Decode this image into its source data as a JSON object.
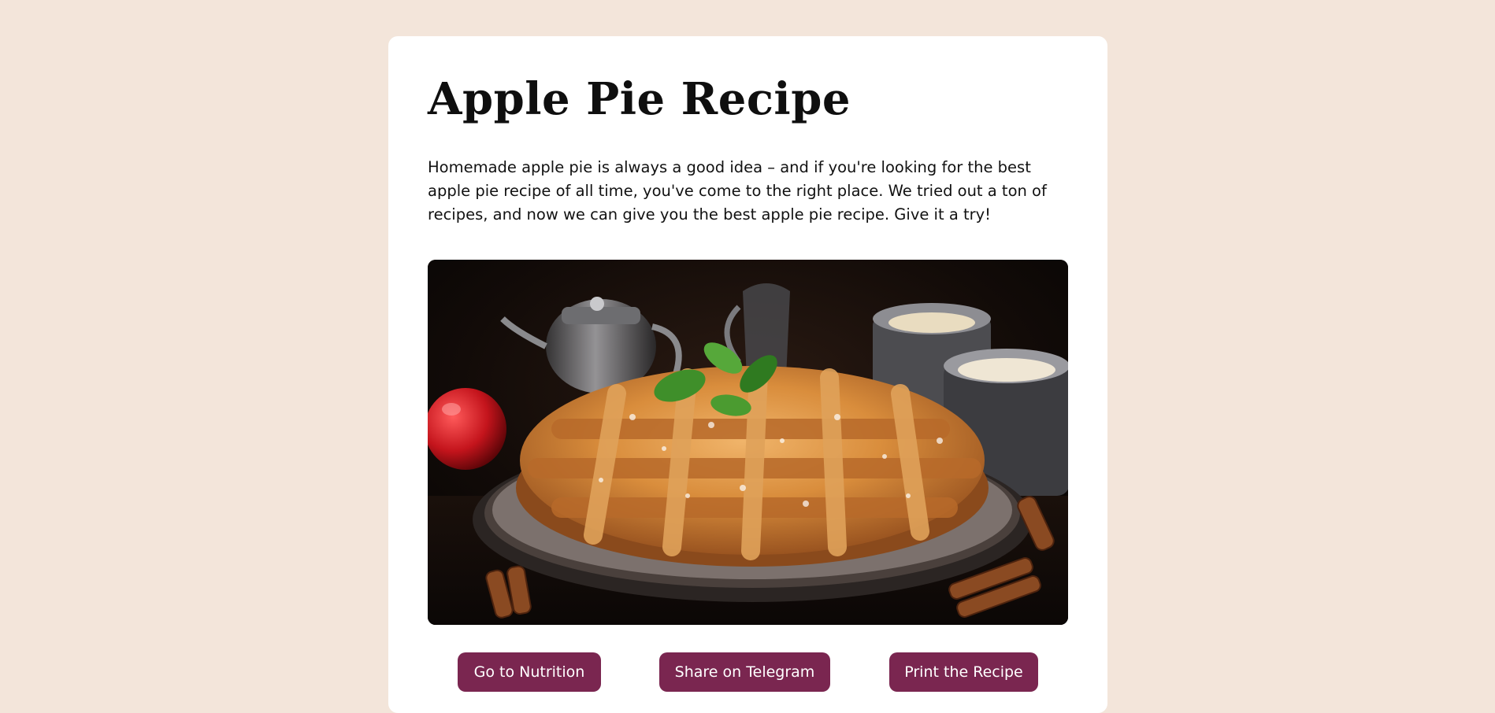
{
  "recipe": {
    "title": "Apple Pie Recipe",
    "intro": "Homemade apple pie is always a good idea – and if you're looking for the best apple pie recipe of all time, you've come to the right place. We tried out a ton of recipes, and now we can give you the best apple pie recipe. Give it a try!"
  },
  "actions": {
    "nutrition_label": "Go to Nutrition",
    "telegram_label": "Share on Telegram",
    "print_label": "Print the Recipe"
  },
  "colors": {
    "page_background": "#f3e5da",
    "card_background": "#ffffff",
    "button_background": "#7a2650",
    "button_text": "#ffffff"
  }
}
